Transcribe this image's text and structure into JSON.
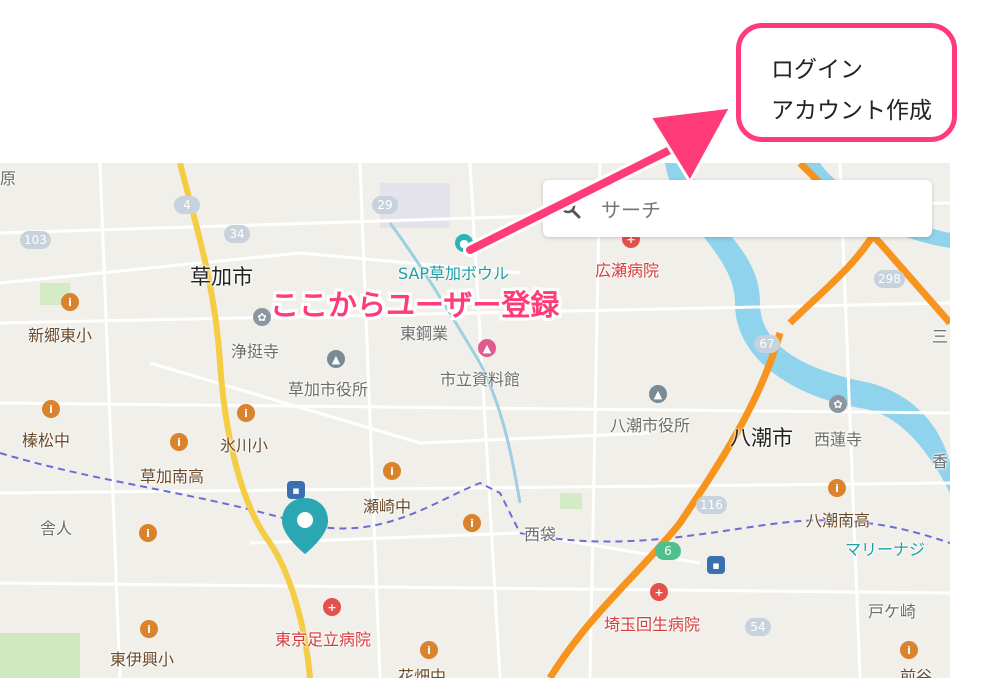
{
  "auth": {
    "login_label": "ログイン",
    "signup_label": "アカウント作成",
    "highlight_color": "#ff3b7a"
  },
  "annotation": {
    "text": "ここからユーザー登録",
    "color": "#ff3b7a"
  },
  "search": {
    "placeholder": "サーチ",
    "icon": "search-icon"
  },
  "map": {
    "cities": [
      "草加市",
      "八潮市"
    ],
    "places": {
      "hara": "原",
      "shingo_higashi": "新郷東小",
      "jotoji": "浄挺寺",
      "soka_city_hall": "草加市役所",
      "sap_bowl": "SAP草加ボウル",
      "higashi_kogyo": "東鋼業",
      "shiritsu_shiryokan": "市立資料館",
      "hirose_hospital": "広瀬病院",
      "hanamatsu_naka": "榛松中",
      "hikawa_sho": "氷川小",
      "soka_minami_ko": "草加南高",
      "yashio_city_hall": "八潮市役所",
      "nishi_renji": "西蓮寺",
      "toneri": "舎人",
      "sezaki_naka": "瀬崎中",
      "nishi_bukuro": "西袋",
      "yashio_minami_ko": "八潮南高",
      "marina": "マリーナジ",
      "sai": "香",
      "tokyo_adachi_hospital": "東京足立病院",
      "higashi_iko_sho": "東伊興小",
      "hanabatake_naka": "花畑中",
      "saitama_kaisei_hospital": "埼玉回生病院",
      "togasaki": "戸ケ崎",
      "mae_ya": "前谷",
      "misato": "三"
    },
    "route_shields": [
      "4",
      "29",
      "34",
      "103",
      "298",
      "67",
      "116",
      "6",
      "54"
    ],
    "colors": {
      "land": "#f1efe9",
      "water": "#8fd3ec",
      "expressway": "#f7941d",
      "major_road": "#f4cd44",
      "boundary": "#6c6cd9"
    }
  }
}
